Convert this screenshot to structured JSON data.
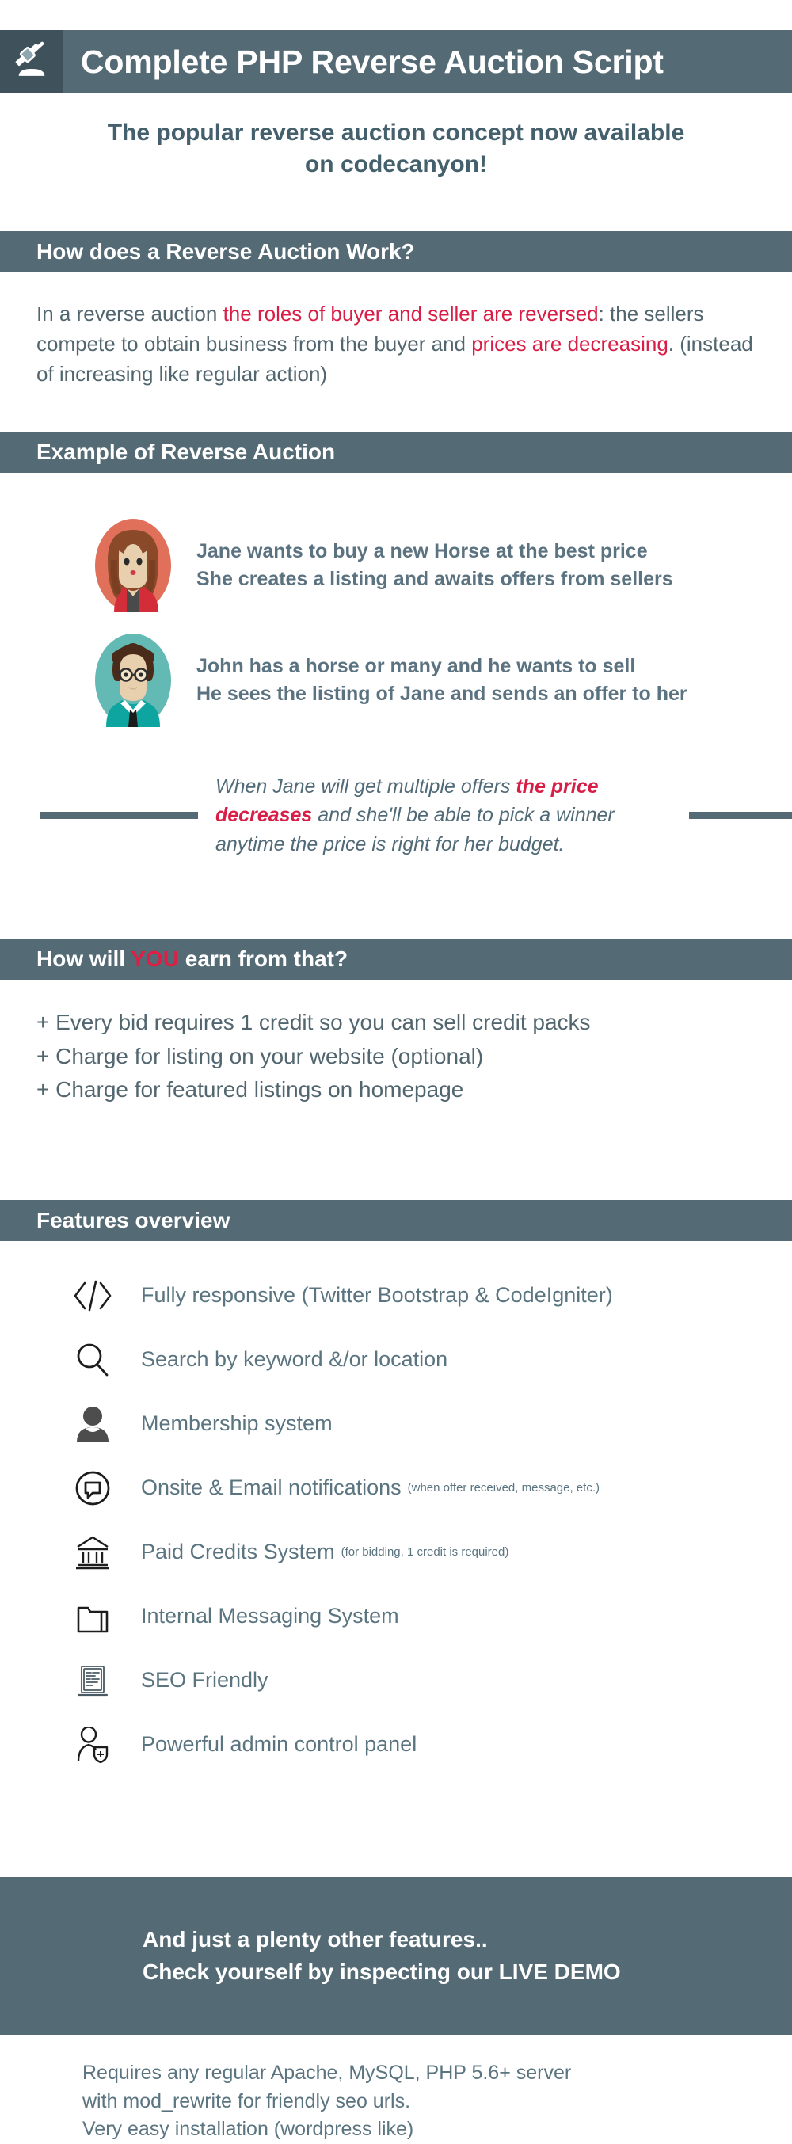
{
  "header": {
    "icon": "gavel-icon",
    "title": "Complete PHP Reverse Auction Script",
    "bar_color": "#546a74",
    "icon_box_color": "#3f525c"
  },
  "subtitle": {
    "line1": "The popular reverse auction concept now available",
    "line2": "on codecanyon!"
  },
  "sections": {
    "how_it_works": {
      "band_label": "How does a Reverse Auction Work?",
      "paragraph": {
        "p1": "In a reverse auction ",
        "r1": "the roles of buyer and seller are reversed",
        "p2": ": the sellers compete to obtain business from the buyer and ",
        "r2": "prices are decreasing",
        "p3": ". (instead of increasing like regular action)"
      }
    },
    "example": {
      "band_label": "Example of Reverse Auction",
      "people": [
        {
          "avatar": "jane-avatar",
          "line1": "Jane wants to buy a new Horse at the best price",
          "line2": "She creates a listing and awaits offers from sellers"
        },
        {
          "avatar": "john-avatar",
          "line1": "John has a horse or many and he wants to sell",
          "line2": "He sees the listing of Jane and sends an offer to her"
        }
      ],
      "quote": {
        "t1": "When Jane will get multiple offers ",
        "r1": "the price decreases",
        "t2": " and she'll be able to pick a winner anytime the price is right for her budget."
      }
    },
    "earn": {
      "band_label_pre": "How will ",
      "band_label_hl": "YOU",
      "band_label_post": " earn from that?",
      "items": [
        "+ Every bid requires 1 credit so you can sell credit packs",
        "+ Charge for listing on your website (optional)",
        "+ Charge for featured listings on homepage"
      ]
    },
    "features": {
      "band_label": "Features overview",
      "items": [
        {
          "icon": "code-icon",
          "label": "Fully responsive (Twitter Bootstrap & CodeIgniter)",
          "note": ""
        },
        {
          "icon": "search-icon",
          "label": "Search by keyword &/or location",
          "note": ""
        },
        {
          "icon": "user-icon",
          "label": "Membership system",
          "note": ""
        },
        {
          "icon": "notification-bubble-icon",
          "label": "Onsite & Email notifications",
          "note": "(when offer received, message, etc.)"
        },
        {
          "icon": "bank-icon",
          "label": "Paid Credits System",
          "note": "(for bidding, 1 credit is required)"
        },
        {
          "icon": "folder-icon",
          "label": "Internal Messaging System",
          "note": ""
        },
        {
          "icon": "seo-document-icon",
          "label": "SEO Friendly",
          "note": ""
        },
        {
          "icon": "admin-shield-user-icon",
          "label": "Powerful admin control panel",
          "note": ""
        }
      ]
    }
  },
  "cta": {
    "line1": "And just a plenty other features..",
    "line2": "Check yourself by inspecting our LIVE DEMO"
  },
  "footer": {
    "line1": "Requires any regular Apache, MySQL, PHP 5.6+ server",
    "line2": "with mod_rewrite for friendly seo urls.",
    "line3": "Very easy installation (wordpress like)"
  },
  "colors": {
    "brand_dark": "#546a74",
    "brand_darker": "#3f525c",
    "accent_red": "#d81e46",
    "body_text": "#52666f"
  }
}
